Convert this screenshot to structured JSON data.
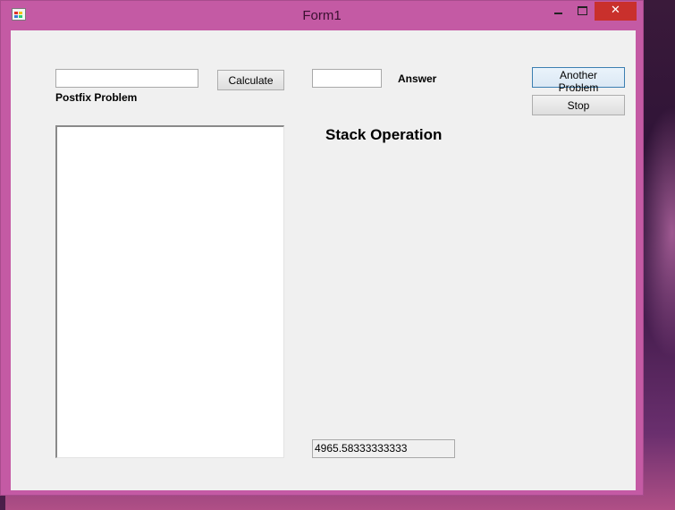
{
  "window": {
    "title": "Form1",
    "close_glyph": "✕"
  },
  "form": {
    "postfix_input": {
      "value": ""
    },
    "postfix_label": "Postfix Problem",
    "calculate_button": "Calculate",
    "answer_input": {
      "value": ""
    },
    "answer_label": "Answer",
    "another_problem_button": "Another Problem",
    "stop_button": "Stop",
    "stack_heading": "Stack Operation",
    "result_text": "4965.58333333333"
  }
}
